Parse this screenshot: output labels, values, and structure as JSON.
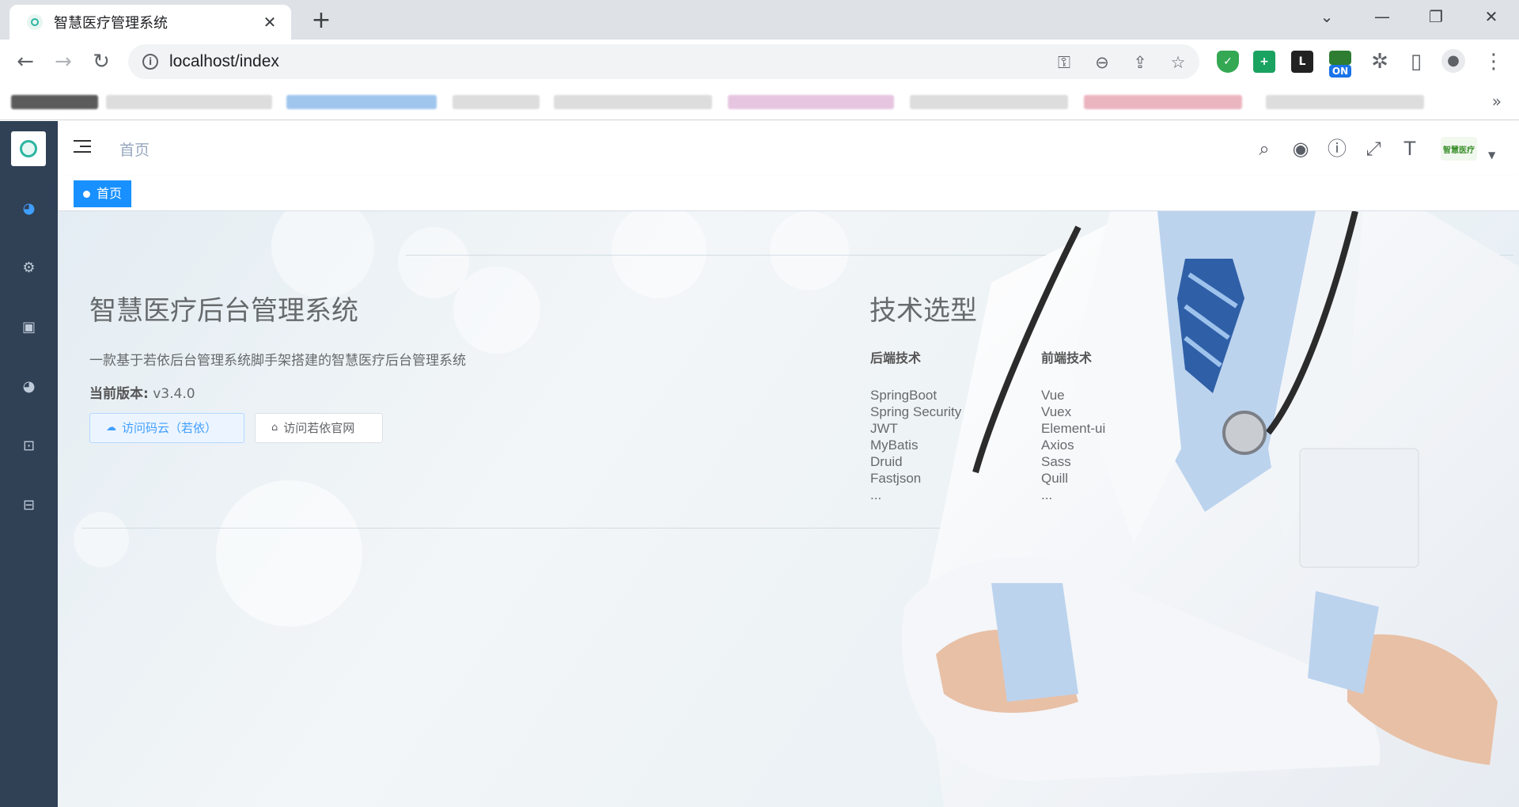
{
  "browser": {
    "tab_title": "智慧医疗管理系统",
    "tab_close": "✕",
    "new_tab": "+",
    "url": "localhost/index",
    "bookmarks_more": "»",
    "extension_on_badge": "ON"
  },
  "app": {
    "breadcrumb": "首页",
    "active_tag": "首页",
    "avatar_text": "智慧医疗",
    "sidebar_icons": [
      "dashboard-icon",
      "settings-icon",
      "monitor-icon",
      "dashboard-icon",
      "chart-icon",
      "toolbox-icon"
    ]
  },
  "intro": {
    "title": "智慧医疗后台管理系统",
    "description": "一款基于若依后台管理系统脚手架搭建的智慧医疗后台管理系统",
    "version_label": "当前版本:",
    "version_value": " v3.4.0",
    "btn_gitee": "访问码云（若依）",
    "btn_site": "访问若依官网"
  },
  "tech": {
    "title": "技术选型",
    "backend_heading": "后端技术",
    "backend": [
      "SpringBoot",
      "Spring Security",
      "JWT",
      "MyBatis",
      "Druid",
      "Fastjson",
      "..."
    ],
    "frontend_heading": "前端技术",
    "frontend": [
      "Vue",
      "Vuex",
      "Element-ui",
      "Axios",
      "Sass",
      "Quill",
      "..."
    ]
  },
  "colors": {
    "sidebar_bg": "#304156",
    "primary": "#1890ff",
    "tag_active": "#1890ff"
  }
}
